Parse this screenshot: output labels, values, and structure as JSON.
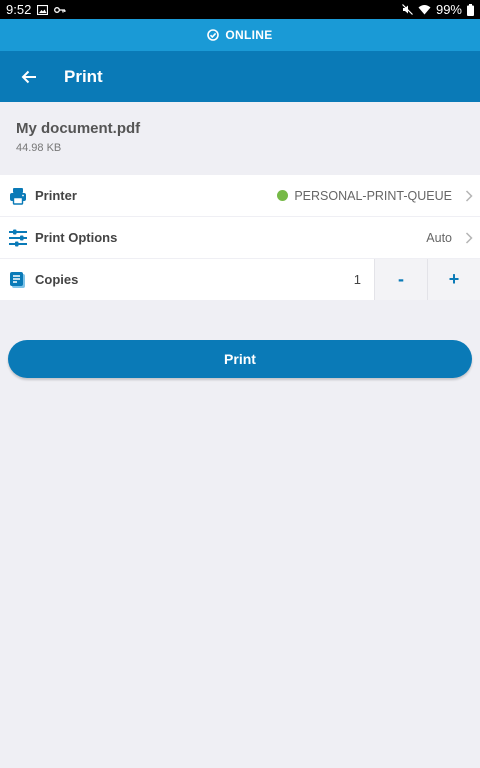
{
  "status_bar": {
    "time": "9:52",
    "battery": "99%",
    "icons_left": [
      "image-icon",
      "key-icon"
    ],
    "icons_right": [
      "mute-icon",
      "wifi-icon",
      "battery-icon"
    ]
  },
  "connection": {
    "status_label": "ONLINE",
    "icon": "check-circle-icon"
  },
  "appbar": {
    "title": "Print",
    "back_icon": "arrow-left-icon"
  },
  "document": {
    "name": "My document.pdf",
    "size": "44.98 KB"
  },
  "settings": {
    "printer": {
      "label": "Printer",
      "value": "PERSONAL-PRINT-QUEUE",
      "status_color": "#76b947",
      "icon": "printer-icon"
    },
    "print_options": {
      "label": "Print Options",
      "value": "Auto",
      "icon": "sliders-icon"
    },
    "copies": {
      "label": "Copies",
      "value": "1",
      "decrement_label": "-",
      "increment_label": "+",
      "icon": "copies-icon"
    }
  },
  "actions": {
    "print_label": "Print"
  },
  "colors": {
    "online_bar": "#1a9ad6",
    "app_bar": "#0a7ab7",
    "background": "#efeff4"
  }
}
